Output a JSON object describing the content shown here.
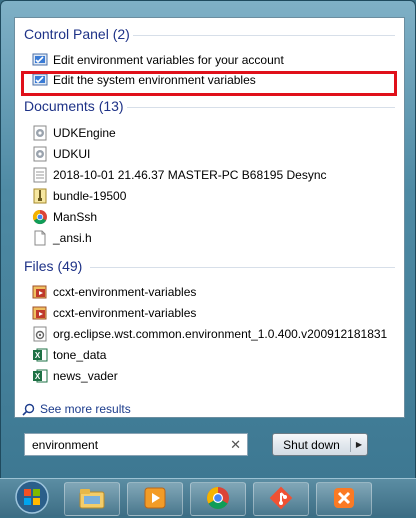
{
  "groups": {
    "control_panel": {
      "title": "Control Panel (2)",
      "items": [
        {
          "label": "Edit environment variables for your account",
          "icon": "control-panel-icon"
        },
        {
          "label": "Edit the system environment variables",
          "icon": "control-panel-icon"
        }
      ]
    },
    "documents": {
      "title": "Documents (13)",
      "items": [
        {
          "label": "UDKEngine",
          "icon": "config-file-icon"
        },
        {
          "label": "UDKUI",
          "icon": "config-file-icon"
        },
        {
          "label": "2018-10-01 21.46.37 MASTER-PC B68195 Desync",
          "icon": "text-file-icon"
        },
        {
          "label": "bundle-19500",
          "icon": "archive-file-icon"
        },
        {
          "label": "ManSsh",
          "icon": "chrome-icon"
        },
        {
          "label": "_ansi.h",
          "icon": "blank-file-icon"
        }
      ]
    },
    "files": {
      "title": "Files (49)",
      "items": [
        {
          "label": "ccxt-environment-variables",
          "icon": "media-file-icon"
        },
        {
          "label": "ccxt-environment-variables",
          "icon": "media-file-icon"
        },
        {
          "label": "org.eclipse.wst.common.environment_1.0.400.v200912181831",
          "icon": "jar-file-icon"
        },
        {
          "label": "tone_data",
          "icon": "excel-icon"
        },
        {
          "label": "news_vader",
          "icon": "excel-icon"
        }
      ]
    }
  },
  "see_more": "See more results",
  "search": {
    "value": "environment"
  },
  "shutdown": {
    "label": "Shut down"
  },
  "taskbar": {
    "items": [
      "file-explorer-icon",
      "media-player-icon",
      "chrome-icon",
      "git-icon",
      "xampp-icon"
    ]
  },
  "colors": {
    "selection_highlight": "#e0101a",
    "group_title": "#1e3287"
  }
}
